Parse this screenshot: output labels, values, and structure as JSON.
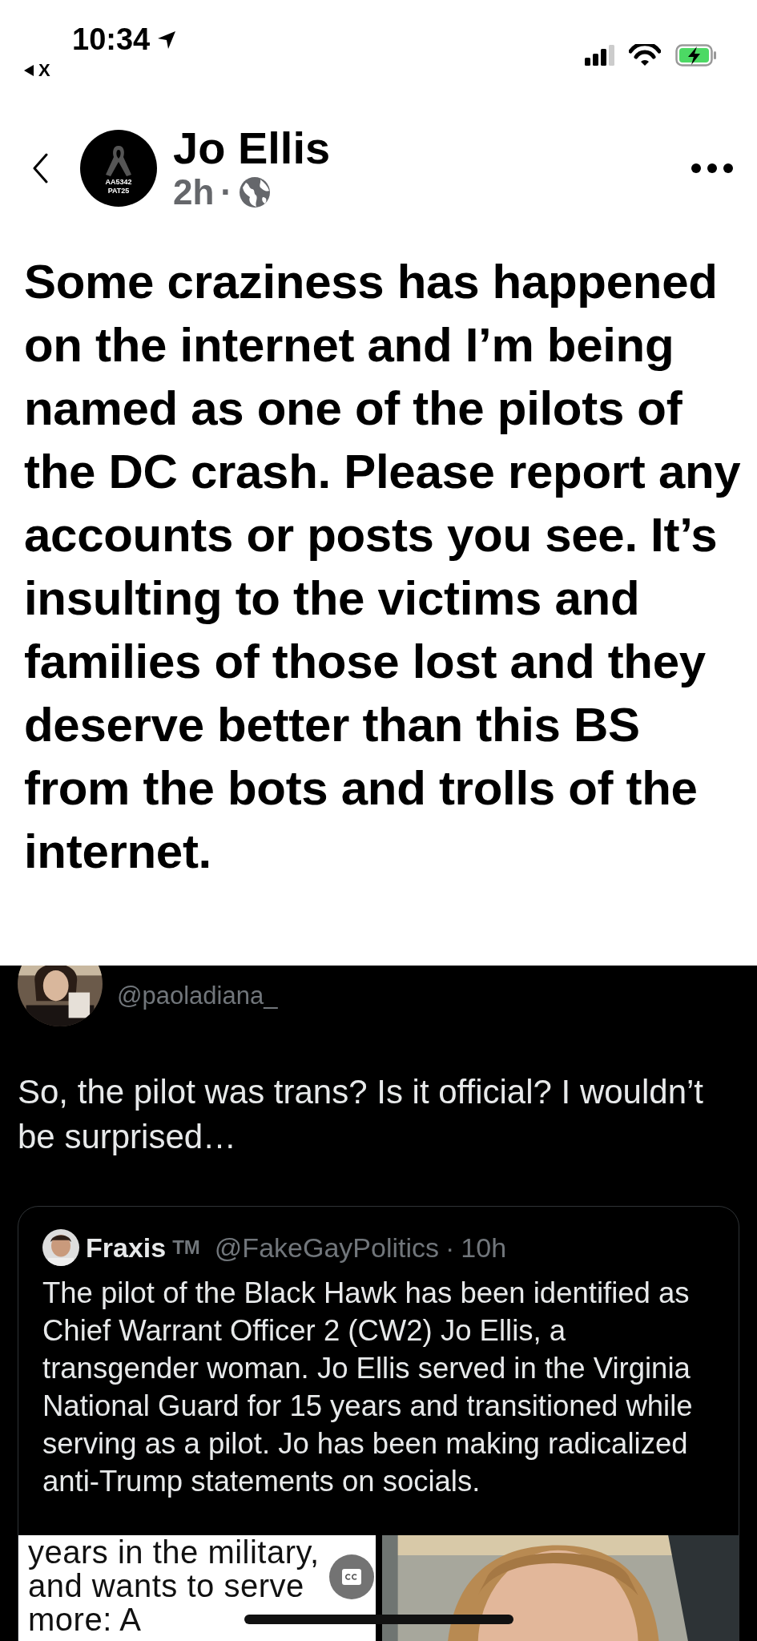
{
  "status_bar": {
    "time": "10:34",
    "back_app": "X"
  },
  "post": {
    "author": "Jo Ellis",
    "avatar_text": [
      "AA5342",
      "PAT25"
    ],
    "age": "2h",
    "separator": "·",
    "text": "Some craziness has happened on the internet and I’m being named as one of the pilots of the DC crash. Please report any accounts or posts you see. It’s insulting to the victims and families of those lost and they deserve better than this BS from the bots and trolls of the internet."
  },
  "screenshot": {
    "handle": "@paoladiana_",
    "text": "So, the pilot was trans? Is it official? I wouldn’t be surprised…",
    "quote": {
      "name": "Fraxis",
      "name_suffix": "TM",
      "handle": "@FakeGayPolitics",
      "separator": "·",
      "age": "10h",
      "text": "The pilot of the Black Hawk has been identified as Chief Warrant Officer 2 (CW2) Jo Ellis, a transgender woman. Jo Ellis served in the Virginia National Guard for 15 years and transitioned while serving as a pilot. Jo has been making radicalized anti-Trump statements on socials.",
      "media_text": "years in the military, and wants to serve more: A"
    }
  }
}
